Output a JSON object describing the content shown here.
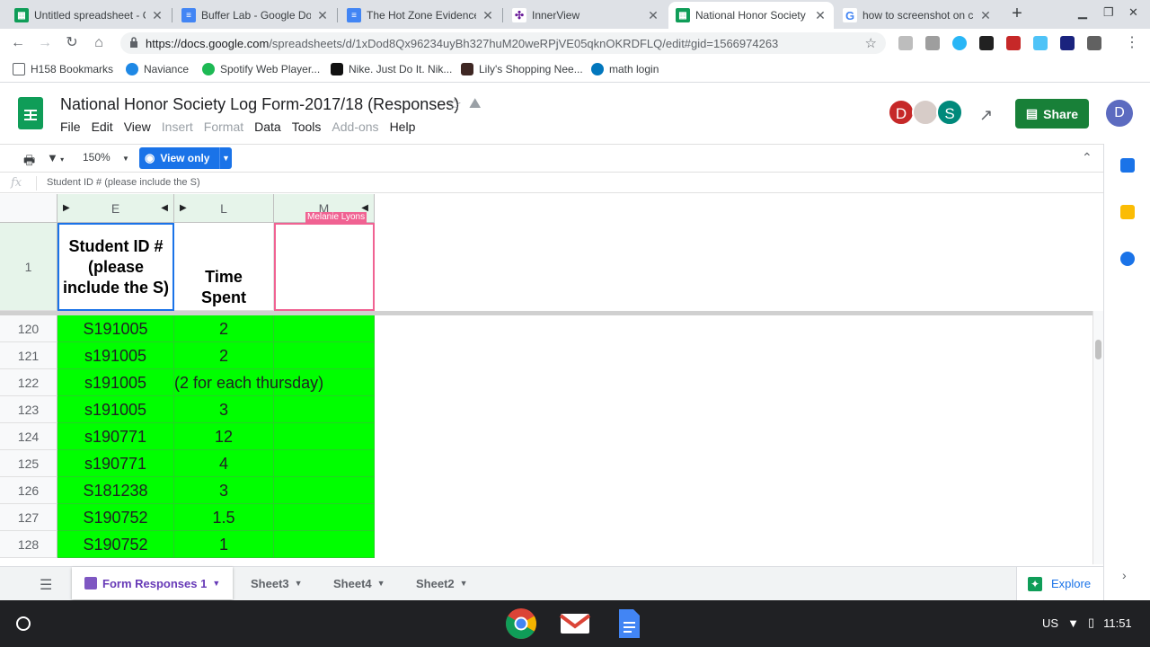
{
  "browser": {
    "tabs": [
      {
        "title": "Untitled spreadsheet - Go",
        "icon": "sheets-icon"
      },
      {
        "title": "Buffer Lab - Google Docs",
        "icon": "docs-icon"
      },
      {
        "title": "The Hot Zone Evidence T",
        "icon": "docs-icon"
      },
      {
        "title": "InnerView",
        "icon": "innerview-icon"
      },
      {
        "title": "National Honor Society L",
        "icon": "sheets-icon",
        "active": true
      },
      {
        "title": "how to screenshot on ch",
        "icon": "google-icon"
      }
    ],
    "url_host": "https://docs.google.com",
    "url_path": "/spreadsheets/d/1xDod8Qx96234uyBh327huM20weRPjVE05qknOKRDFLQ/edit#gid=1566974263"
  },
  "bookmarks": [
    {
      "label": "H158 Bookmarks",
      "icon": "folder-icon"
    },
    {
      "label": "Naviance",
      "icon": "naviance-icon"
    },
    {
      "label": "Spotify Web Player...",
      "icon": "spotify-icon"
    },
    {
      "label": "Nike. Just Do It. Nik...",
      "icon": "nike-icon"
    },
    {
      "label": "Lily's Shopping Nee...",
      "icon": "af-icon"
    },
    {
      "label": "math login",
      "icon": "math-icon"
    }
  ],
  "doc": {
    "title": "National Honor Society Log Form-2017/18 (Responses)",
    "menus": [
      "File",
      "Edit",
      "View",
      "Insert",
      "Format",
      "Data",
      "Tools",
      "Add-ons",
      "Help"
    ],
    "disabled_menus": [
      "Insert",
      "Format",
      "Add-ons"
    ],
    "share_label": "Share",
    "collaborators": [
      "D",
      "S"
    ],
    "account_initial": "D"
  },
  "toolbar": {
    "zoom": "150%",
    "mode_label": "View only"
  },
  "formula_bar": {
    "fx": "fx",
    "content": "Student ID # (please include the S)"
  },
  "grid": {
    "columns": [
      "E",
      "L",
      "M"
    ],
    "collaborator_tag": "Melanie Lyons",
    "header_row_number": "1",
    "header_cells": {
      "E": "Student ID # (please include the S)",
      "L": "Time Spent",
      "M": ""
    },
    "rows": [
      {
        "num": "120",
        "E": "S191005",
        "L": "2"
      },
      {
        "num": "121",
        "E": "s191005",
        "L": "2"
      },
      {
        "num": "122",
        "E": "s191005",
        "L": "(2 for each thursday)"
      },
      {
        "num": "123",
        "E": "s191005",
        "L": "3"
      },
      {
        "num": "124",
        "E": "s190771",
        "L": "12"
      },
      {
        "num": "125",
        "E": "s190771",
        "L": "4"
      },
      {
        "num": "126",
        "E": "S181238",
        "L": "3"
      },
      {
        "num": "127",
        "E": "S190752",
        "L": "1.5"
      },
      {
        "num": "128",
        "E": "S190752",
        "L": "1"
      }
    ],
    "fill_color": "#00ff00"
  },
  "sheet_tabs": [
    {
      "label": "Form Responses 1",
      "active": true
    },
    {
      "label": "Sheet3"
    },
    {
      "label": "Sheet4"
    },
    {
      "label": "Sheet2"
    }
  ],
  "explore_label": "Explore",
  "tray": {
    "locale": "US",
    "time": "11:51"
  }
}
